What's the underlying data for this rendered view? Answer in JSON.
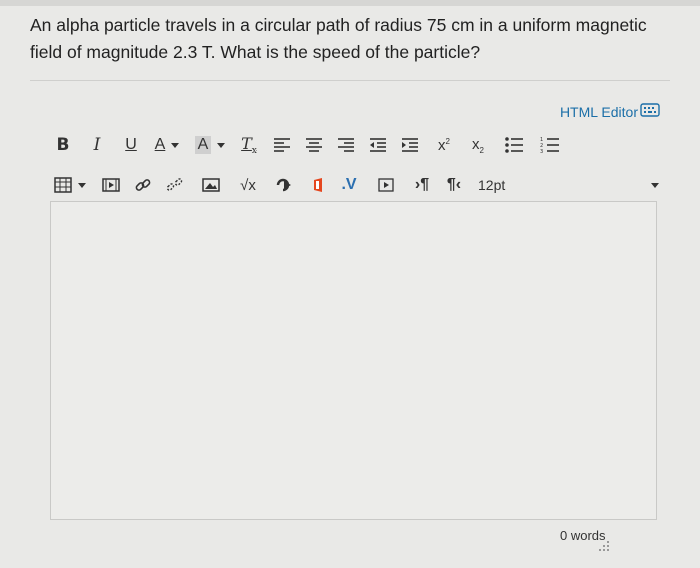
{
  "question": {
    "text": "An alpha particle travels in a circular path of radius 75 cm in a uniform magnetic field of magnitude 2.3 T. What is the speed of the particle?"
  },
  "editor": {
    "html_editor_label": "HTML Editor",
    "toolbar_row1": [
      {
        "name": "bold-button",
        "icon": "bold-icon"
      },
      {
        "name": "italic-button",
        "icon": "italic-icon"
      },
      {
        "name": "underline-button",
        "icon": "underline-icon"
      },
      {
        "name": "text-color-button",
        "icon": "text-color-icon"
      },
      {
        "name": "background-color-button",
        "icon": "background-color-icon"
      },
      {
        "name": "clear-formatting-button",
        "icon": "clear-formatting-icon"
      },
      {
        "name": "align-left-button",
        "icon": "align-left-icon"
      },
      {
        "name": "align-center-button",
        "icon": "align-center-icon"
      },
      {
        "name": "align-right-button",
        "icon": "align-right-icon"
      },
      {
        "name": "outdent-button",
        "icon": "outdent-icon"
      },
      {
        "name": "indent-button",
        "icon": "indent-icon"
      },
      {
        "name": "superscript-button",
        "icon": "superscript-icon"
      },
      {
        "name": "subscript-button",
        "icon": "subscript-icon"
      },
      {
        "name": "bullet-list-button",
        "icon": "bullet-list-icon"
      },
      {
        "name": "numbered-list-button",
        "icon": "numbered-list-icon"
      }
    ],
    "toolbar_row2": [
      {
        "name": "table-button",
        "icon": "table-icon"
      },
      {
        "name": "media-button",
        "icon": "media-icon"
      },
      {
        "name": "link-button",
        "icon": "link-icon"
      },
      {
        "name": "unlink-button",
        "icon": "unlink-icon"
      },
      {
        "name": "image-button",
        "icon": "image-icon"
      },
      {
        "name": "equation-button",
        "icon": "equation-icon"
      },
      {
        "name": "embed-button",
        "icon": "embed-icon"
      },
      {
        "name": "office-button",
        "icon": "office-icon"
      },
      {
        "name": "v-button",
        "icon": "v-icon"
      },
      {
        "name": "video-button",
        "icon": "video-icon"
      },
      {
        "name": "ltr-button",
        "icon": "ltr-icon"
      },
      {
        "name": "rtl-button",
        "icon": "rtl-icon"
      }
    ],
    "font_size": "12pt",
    "word_count": "0 words",
    "colors": {
      "link": "#1c6fa8",
      "text_color_a": "#333333",
      "bg_color_a": "#cfcfcf",
      "office": "#e5471f",
      "v_icon": "#2b6fb0"
    }
  }
}
